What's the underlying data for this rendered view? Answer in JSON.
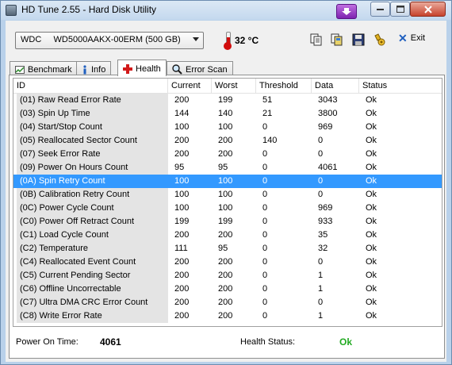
{
  "window": {
    "title": "HD Tune 2.55 - Hard Disk Utility"
  },
  "toolbar": {
    "drive": "WDC     WD5000AAKX-00ERM (500 GB)",
    "temperature": "32 °C",
    "exit_label": "Exit"
  },
  "tabs": [
    {
      "label": "Benchmark",
      "icon": "benchmark-icon"
    },
    {
      "label": "Info",
      "icon": "info-icon"
    },
    {
      "label": "Health",
      "icon": "health-cross-icon"
    },
    {
      "label": "Error Scan",
      "icon": "magnifier-icon"
    }
  ],
  "active_tab": "Health",
  "health": {
    "columns": [
      "ID",
      "Current",
      "Worst",
      "Threshold",
      "Data",
      "Status"
    ],
    "rows": [
      [
        "(01) Raw Read Error Rate",
        "200",
        "199",
        "51",
        "3043",
        "Ok"
      ],
      [
        "(03) Spin Up Time",
        "144",
        "140",
        "21",
        "3800",
        "Ok"
      ],
      [
        "(04) Start/Stop Count",
        "100",
        "100",
        "0",
        "969",
        "Ok"
      ],
      [
        "(05) Reallocated Sector Count",
        "200",
        "200",
        "140",
        "0",
        "Ok"
      ],
      [
        "(07) Seek Error Rate",
        "200",
        "200",
        "0",
        "0",
        "Ok"
      ],
      [
        "(09) Power On Hours Count",
        "95",
        "95",
        "0",
        "4061",
        "Ok"
      ],
      [
        "(0A) Spin Retry Count",
        "100",
        "100",
        "0",
        "0",
        "Ok"
      ],
      [
        "(0B) Calibration Retry Count",
        "100",
        "100",
        "0",
        "0",
        "Ok"
      ],
      [
        "(0C) Power Cycle Count",
        "100",
        "100",
        "0",
        "969",
        "Ok"
      ],
      [
        "(C0) Power Off Retract Count",
        "199",
        "199",
        "0",
        "933",
        "Ok"
      ],
      [
        "(C1) Load Cycle Count",
        "200",
        "200",
        "0",
        "35",
        "Ok"
      ],
      [
        "(C2) Temperature",
        "111",
        "95",
        "0",
        "32",
        "Ok"
      ],
      [
        "(C4) Reallocated Event Count",
        "200",
        "200",
        "0",
        "0",
        "Ok"
      ],
      [
        "(C5) Current Pending Sector",
        "200",
        "200",
        "0",
        "1",
        "Ok"
      ],
      [
        "(C6) Offline Uncorrectable",
        "200",
        "200",
        "0",
        "1",
        "Ok"
      ],
      [
        "(C7) Ultra DMA CRC Error Count",
        "200",
        "200",
        "0",
        "0",
        "Ok"
      ],
      [
        "(C8) Write Error Rate",
        "200",
        "200",
        "0",
        "1",
        "Ok"
      ]
    ],
    "selected_row": "(0A) Spin Retry Count",
    "power_on_time_label": "Power On Time:",
    "power_on_time_value": "4061",
    "health_status_label": "Health Status:",
    "health_status_value": "Ok"
  },
  "colors": {
    "selection": "#3399ff",
    "status_ok": "#22aa22",
    "temperature_icon": "#d10d0d"
  }
}
